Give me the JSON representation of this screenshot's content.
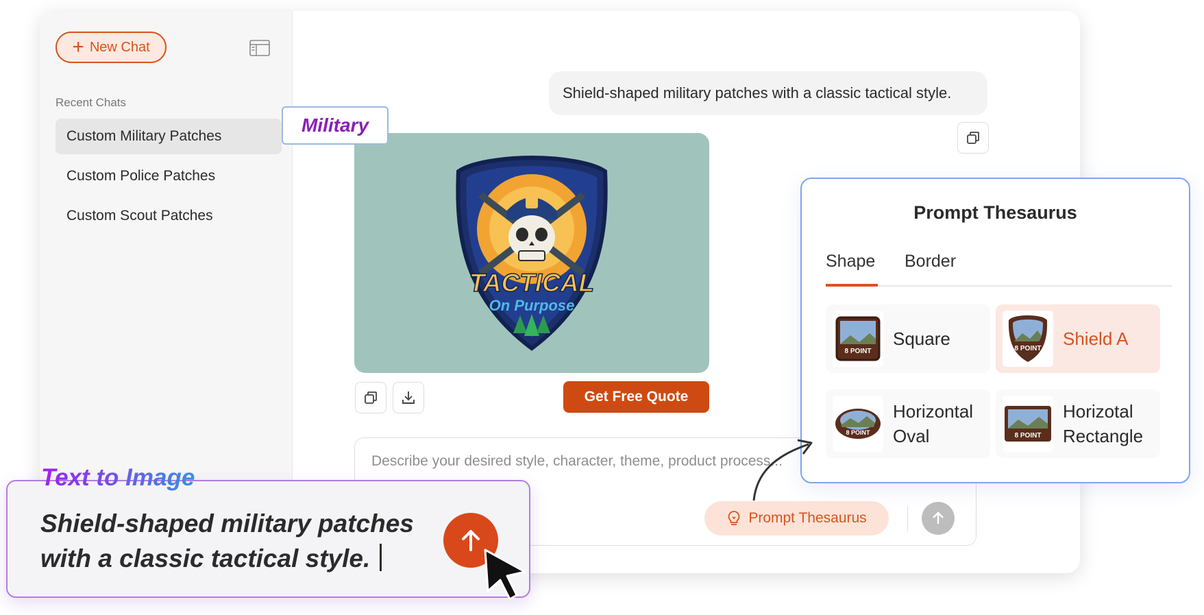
{
  "sidebar": {
    "new_chat_label": "New Chat",
    "recent_label": "Recent Chats",
    "items": [
      {
        "label": "Custom Military Patches",
        "active": true
      },
      {
        "label": "Custom Police Patches",
        "active": false
      },
      {
        "label": "Custom Scout Patches",
        "active": false
      }
    ]
  },
  "chat": {
    "user_message": "Shield-shaped military patches with a classic tactical style.",
    "image_tag": "Military",
    "patch_text": {
      "line1": "TACTICAL",
      "line2": "On Purpose"
    },
    "quote_button": "Get Free Quote",
    "input_placeholder": "Describe your desired style, character, theme, product process...",
    "prompt_thesaurus_button": "Prompt Thesaurus"
  },
  "thesaurus": {
    "title": "Prompt Thesaurus",
    "tabs": [
      {
        "label": "Shape",
        "active": true
      },
      {
        "label": "Border",
        "active": false
      }
    ],
    "items": [
      {
        "label": "Square",
        "active": false
      },
      {
        "label": "Shield A",
        "active": true
      },
      {
        "label": "Horizontal Oval",
        "active": false
      },
      {
        "label": "Horizotal Rectangle",
        "active": false
      }
    ],
    "thumb_text": "8 POINT"
  },
  "overlay": {
    "title": "Text to Image",
    "prompt": "Shield-shaped military patches with a classic tactical style."
  },
  "colors": {
    "accent": "#d9531e",
    "quote_button": "#cf4a12",
    "image_bg": "#a0c4bb",
    "tag_text": "#8a1fb6",
    "thesaurus_border": "#7ea6ec"
  },
  "icons": [
    "plus-icon",
    "sidebar-panel-icon",
    "copy-icon",
    "download-icon",
    "lightbulb-icon",
    "arrow-up-icon",
    "cursor-arrow-icon"
  ]
}
